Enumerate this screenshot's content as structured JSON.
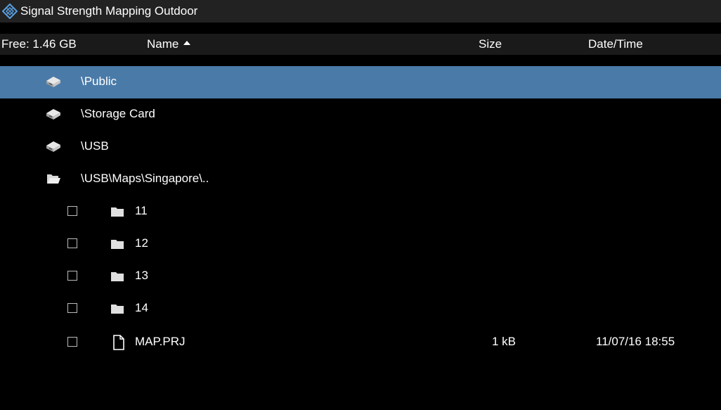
{
  "window": {
    "title": "Signal Strength Mapping Outdoor"
  },
  "header": {
    "free_space": "Free: 1.46 GB",
    "col_name": "Name",
    "col_size": "Size",
    "col_date": "Date/Time"
  },
  "drives": [
    {
      "label": "\\Public",
      "icon": "drive-icon",
      "selected": true
    },
    {
      "label": "\\Storage Card",
      "icon": "drive-icon"
    },
    {
      "label": "\\USB",
      "icon": "drive-icon"
    }
  ],
  "current_folder": {
    "label": "\\USB\\Maps\\Singapore\\..",
    "icon": "open-folder-icon"
  },
  "items": [
    {
      "name": "11",
      "type": "folder",
      "checked": false
    },
    {
      "name": "12",
      "type": "folder",
      "checked": false
    },
    {
      "name": "13",
      "type": "folder",
      "checked": false
    },
    {
      "name": "14",
      "type": "folder",
      "checked": false
    },
    {
      "name": "MAP.PRJ",
      "type": "file",
      "size": "1 kB",
      "date": "11/07/16 18:55",
      "checked": false
    }
  ],
  "colors": {
    "title_bg": "#222222",
    "header_bg": "#1a1a1a",
    "selection": "#4a7aa8",
    "background": "#000000"
  }
}
